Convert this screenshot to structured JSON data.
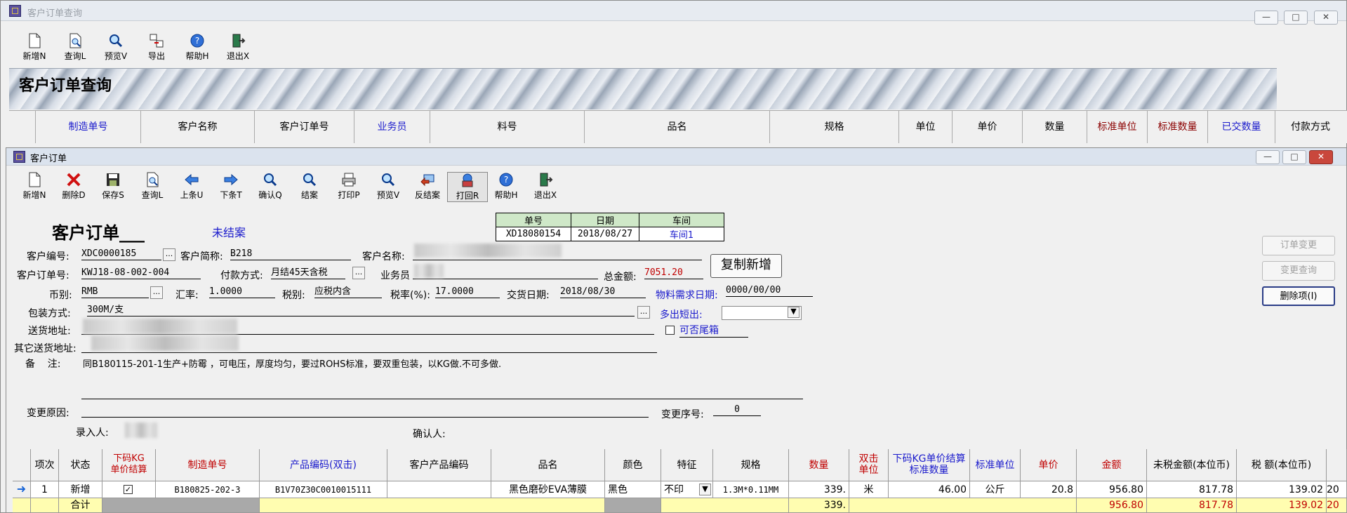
{
  "back_window": {
    "title": "客户订单查询",
    "toolbar": [
      "新增N",
      "查询L",
      "预览V",
      "导出",
      "帮助H",
      "退出X"
    ],
    "banner_title": "客户订单查询",
    "columns": [
      "制造单号",
      "客户名称",
      "客户订单号",
      "业务员",
      "料号",
      "品名",
      "规格",
      "单位",
      "单价",
      "数量",
      "标准单位",
      "标准数量",
      "已交数量",
      "付款方式"
    ]
  },
  "order_window": {
    "title": "客户订单",
    "toolbar": [
      "新增N",
      "删除D",
      "保存S",
      "查询L",
      "上条U",
      "下条T",
      "确认Q",
      "结案",
      "打印P",
      "预览V",
      "反结案",
      "打回R",
      "帮助H",
      "退出X"
    ],
    "form_title": "客户订单___",
    "status": "未结案",
    "header_table": {
      "h_no": "单号",
      "h_date": "日期",
      "h_ws": "车间",
      "no": "XD18080154",
      "date": "2018/08/27",
      "ws": "车间1"
    },
    "labels": {
      "cust_code": "客户编号:",
      "cust_short": "客户简称:",
      "cust_name": "客户名称:",
      "cust_order": "客户订单号:",
      "pay": "付款方式:",
      "sales": "业务员",
      "total": "总金额:",
      "currency": "币别:",
      "rate": "汇率:",
      "tax_type": "税别:",
      "tax_rate": "税率(%):",
      "deliver_date": "交货日期:",
      "material_date": "物料需求日期:",
      "pack": "包装方式:",
      "over_short": "多出短出:",
      "ship_addr": "送货地址:",
      "tail_box": "可否尾箱",
      "other_addr": "其它送货地址:",
      "remark": "备    注:",
      "change_reason": "变更原因:",
      "change_seq": "变更序号:",
      "entry": "录入人:",
      "confirm": "确认人:"
    },
    "values": {
      "cust_code": "XDC0000185",
      "cust_short": "B218",
      "cust_order": "KWJ18-08-002-004",
      "pay": "月结45天含税",
      "total": "7051.20",
      "currency": "RMB",
      "rate": "1.0000",
      "tax_type": "应税内含",
      "tax_rate": "17.0000",
      "deliver_date": "2018/08/30",
      "material_date": "0000/00/00",
      "pack": "300M/支",
      "remark": "同B180115-201-1生产+防霉 ，可电压，厚度均匀，要过ROHS标准，要双重包装，以KG做.不可多做.",
      "change_seq": "0"
    },
    "buttons": {
      "copy_new": "复制新增",
      "order_change": "订单变更",
      "change_query": "变更查询",
      "delete_item": "删除项(I)"
    },
    "grid": {
      "headers": [
        "项次",
        "状态",
        "下码KG\n单价结算",
        "制造单号",
        "产品编码(双击)",
        "客户产品编码",
        "品名",
        "颜色",
        "特征",
        "规格",
        "数量",
        "双击\n单位",
        "下码KG单价结算\n标准数量",
        "标准单位",
        "单价",
        "金额",
        "未税金额(本位币)",
        "税  额(本位币)"
      ],
      "row": {
        "item": "1",
        "status": "新增",
        "mo": "B180825-202-3",
        "code": "B1V70Z30C0010015111",
        "cust_code": "",
        "name": "黑色磨砂EVA薄膜",
        "color": "黑色",
        "feature": "不印",
        "spec": "1.3M*0.11MM",
        "qty": "339.",
        "unit": "米",
        "std_qty": "46.00",
        "std_unit": "公斤",
        "price": "20.8",
        "amount": "956.80",
        "net": "817.78",
        "tax": "139.02",
        "extra": "20"
      },
      "total": {
        "label": "合计",
        "qty": "339.",
        "amount": "956.80",
        "net": "817.78",
        "tax": "139.02",
        "extra": "20"
      }
    }
  }
}
